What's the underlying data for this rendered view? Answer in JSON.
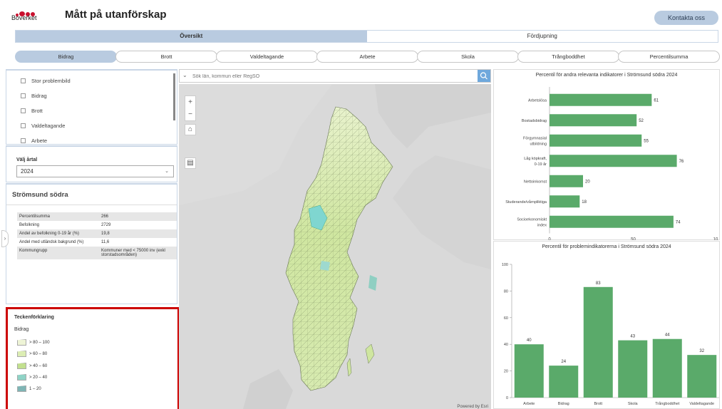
{
  "header": {
    "logo_text": "Boverket",
    "title": "Mått på utanförskap",
    "contact_label": "Kontakta oss"
  },
  "main_tabs": [
    {
      "label": "Översikt",
      "active": true
    },
    {
      "label": "Fördjupning",
      "active": false
    }
  ],
  "sub_tabs": [
    "Bidrag",
    "Brott",
    "Valdeltagande",
    "Arbete",
    "Skola",
    "Trångboddhet",
    "Percentilsumma"
  ],
  "indicator_list": [
    "Stor problembild",
    "Bidrag",
    "Brott",
    "Valdeltagande",
    "Arbete"
  ],
  "year": {
    "label": "Välj årtal",
    "value": "2024"
  },
  "region": {
    "name": "Strömsund södra",
    "rows": [
      {
        "label": "Percentilsumma",
        "value": "266"
      },
      {
        "label": "Befolkning",
        "value": "2729"
      },
      {
        "label": "Andel av befolkning 0-19 år (%)",
        "value": "19,8"
      },
      {
        "label": "Andel med utländsk bakgrund (%)",
        "value": "11,6"
      },
      {
        "label": "Kommungrupp",
        "value": "Kommuner med < 75000 inv (exkl storstadsområden)"
      }
    ]
  },
  "legend": {
    "title": "Teckenförklaring",
    "subtitle": "Bidrag",
    "items": [
      {
        "label": "> 80 – 100",
        "color": "#eef4d6"
      },
      {
        "label": "> 60 – 80",
        "color": "#dcedb3"
      },
      {
        "label": "> 40 – 60",
        "color": "#c2e08e"
      },
      {
        "label": "> 20 – 40",
        "color": "#8fd3c6"
      },
      {
        "label": "1 – 20",
        "color": "#7fb5b5"
      }
    ]
  },
  "map": {
    "search_placeholder": "Sök län, kommun eller RegSO",
    "attribution": "Powered by Esri"
  },
  "colors": {
    "bar": "#5aaa6a",
    "accent": "#b9cbe0"
  },
  "chart_data": [
    {
      "type": "bar",
      "orientation": "horizontal",
      "title": "Percentil för andra relevanta indikatorer i Strömsund södra 2024",
      "categories": [
        "Arbetslösa",
        "Bostadsbidrag",
        "Förgymnasial utbildning",
        "Låg köpkraft, 0-19 år",
        "Nettoinkomst",
        "Studerande/vårnpliktiga",
        "Socioekonomiskt index"
      ],
      "category_lines": [
        [
          "Arbetslösa"
        ],
        [
          "Bostadsbidrag"
        ],
        [
          "Förgymnasial",
          "utbildning"
        ],
        [
          "Låg köpkraft,",
          "0-19 år"
        ],
        [
          "Nettoinkomst"
        ],
        [
          "Studerande/vårnpliktiga"
        ],
        [
          "Socioekonomiskt",
          "index"
        ]
      ],
      "values": [
        61,
        52,
        55,
        76,
        20,
        18,
        74
      ],
      "xlim": [
        0,
        100
      ],
      "xticks": [
        "0",
        "50",
        "10"
      ]
    },
    {
      "type": "bar",
      "title": "Percentil för problemindikatorerna i Strömsund södra 2024",
      "categories": [
        "Arbete",
        "Bidrag",
        "Brott",
        "Skola",
        "Trångboddhet",
        "Valdeltagande"
      ],
      "values": [
        40,
        24,
        83,
        43,
        44,
        32
      ],
      "ylim": [
        0,
        100
      ],
      "yticks": [
        0,
        20,
        40,
        60,
        80,
        100
      ]
    }
  ]
}
